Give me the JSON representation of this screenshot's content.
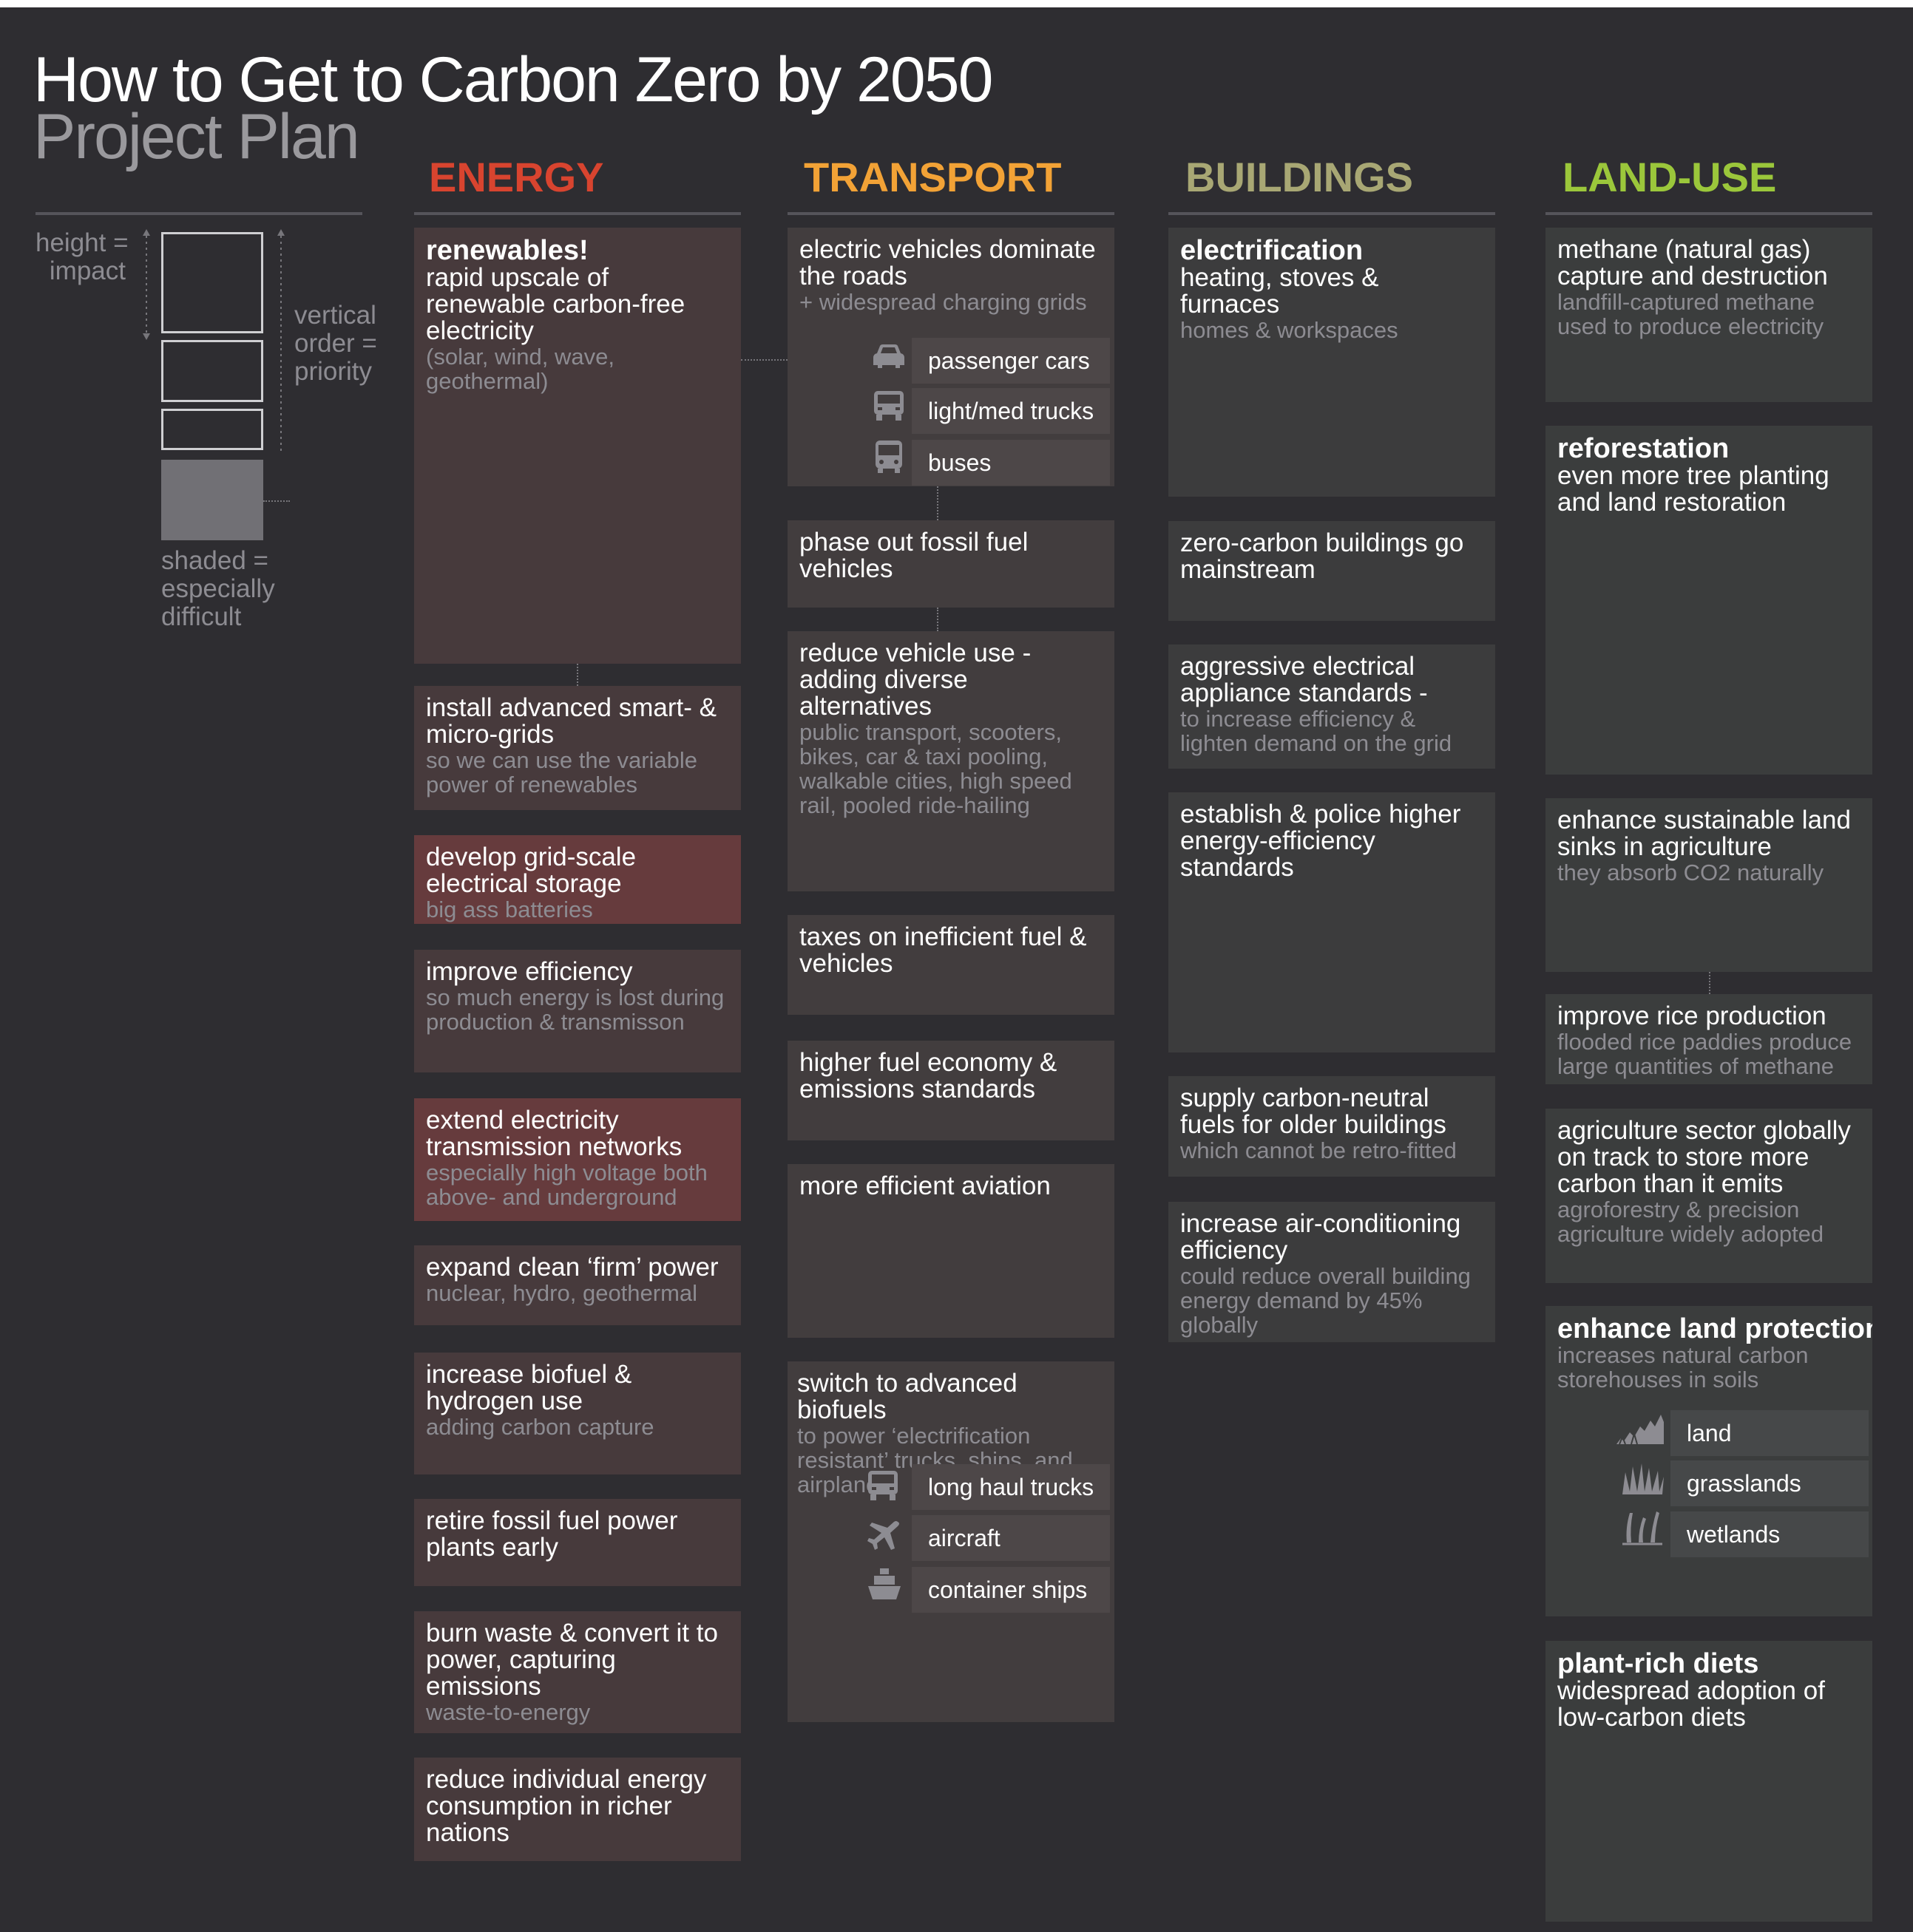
{
  "title": "How to Get to Carbon Zero by 2050",
  "subtitle": "Project Plan",
  "legend": {
    "height_text": "height =\nimpact",
    "order_text": "vertical\norder =\npriority",
    "shaded_text": "shaded =\nespecially\ndifficult"
  },
  "colors": {
    "energy": "#d8442f",
    "transport": "#f2a236",
    "buildings": "#a8a774",
    "landuse": "#9bc73b"
  },
  "columns": {
    "energy": {
      "header": "ENERGY",
      "items": [
        {
          "bold": "renewables!",
          "main": "rapid upscale of renewable carbon-free electricity",
          "sub": "(solar, wind, wave, geothermal)",
          "difficult": false
        },
        {
          "main": "install advanced smart- & micro-grids",
          "sub": "so we can use the variable power of renewables",
          "difficult": false
        },
        {
          "main": "develop  grid-scale electrical storage",
          "sub": "big ass batteries",
          "difficult": true
        },
        {
          "main": "improve efficiency",
          "sub": "so much energy is lost during production & transmisson",
          "difficult": false
        },
        {
          "main": "extend electricity transmission networks",
          "sub": "especially high voltage both above- and underground",
          "difficult": true
        },
        {
          "main": "expand clean ‘firm’ power",
          "sub": "nuclear, hydro, geothermal",
          "difficult": false
        },
        {
          "main": "increase biofuel & hydrogen use",
          "sub": "adding carbon capture",
          "difficult": false
        },
        {
          "main": "retire fossil fuel power plants early",
          "difficult": false
        },
        {
          "main": "burn waste & convert it to power, capturing emissions",
          "sub": "waste-to-energy",
          "difficult": false
        },
        {
          "main": "reduce individual energy consumption in richer nations",
          "difficult": false
        }
      ]
    },
    "transport": {
      "header": "TRANSPORT",
      "items": [
        {
          "main": "electric vehicles dominate the roads",
          "sub": "+ widespread charging grids",
          "vehicles": [
            {
              "icon": "car-icon",
              "label": "passenger cars"
            },
            {
              "icon": "truck-icon",
              "label": "light/med trucks"
            },
            {
              "icon": "bus-icon",
              "label": "buses"
            }
          ]
        },
        {
          "main": "phase out fossil fuel vehicles"
        },
        {
          "main": "reduce vehicle use - adding diverse alternatives",
          "sub": "public transport, scooters, bikes, car & taxi pooling, walkable cities, high speed rail, pooled ride-hailing"
        },
        {
          "main": "taxes on inefficient fuel & vehicles"
        },
        {
          "main": "higher fuel economy & emissions standards"
        },
        {
          "main": "more efficient aviation"
        },
        {
          "main": "switch to advanced biofuels",
          "sub": "to power ‘electrification resistant’ trucks, ships, and airplanes",
          "vehicles": [
            {
              "icon": "truck-icon",
              "label": "long haul trucks"
            },
            {
              "icon": "airplane-icon",
              "label": "aircraft"
            },
            {
              "icon": "ship-icon",
              "label": "container ships"
            }
          ]
        }
      ]
    },
    "buildings": {
      "header": "BUILDINGS",
      "items": [
        {
          "bold": "electrification",
          "main": "heating, stoves & furnaces",
          "sub": "homes & workspaces"
        },
        {
          "main": "zero-carbon buildings go mainstream"
        },
        {
          "main": "aggressive electrical appliance standards -",
          "sub": "to increase efficiency & lighten demand on the grid"
        },
        {
          "main": "establish & police higher energy-efficiency standards"
        },
        {
          "main": "supply carbon-neutral fuels for older buildings",
          "sub": "which cannot be retro-fitted"
        },
        {
          "main": "increase air-conditioning efficiency",
          "sub": "could reduce overall building energy demand by 45% globally"
        }
      ]
    },
    "landuse": {
      "header": "LAND-USE",
      "items": [
        {
          "main": "methane (natural gas) capture and destruction",
          "sub": "landfill-captured methane used to produce electricity"
        },
        {
          "bold": "reforestation",
          "main": "even more tree planting and land restoration"
        },
        {
          "main": "enhance sustainable land sinks in agriculture",
          "sub": "they  absorb CO2 naturally"
        },
        {
          "main": "improve rice production",
          "sub": "flooded rice paddies produce large quantities of methane"
        },
        {
          "main": "agriculture sector globally on track to store more carbon than it emits",
          "sub": "agroforestry & precision agriculture widely adopted"
        },
        {
          "bold": "enhance land protection",
          "sub": "increases natural carbon storehouses in soils",
          "ecosystems": [
            {
              "icon": "land-icon",
              "label": "land"
            },
            {
              "icon": "grass-icon",
              "label": "grasslands"
            },
            {
              "icon": "wetland-icon",
              "label": "wetlands"
            }
          ]
        },
        {
          "bold": "plant-rich diets",
          "main": "widespread adoption of low-carbon diets"
        }
      ]
    }
  }
}
